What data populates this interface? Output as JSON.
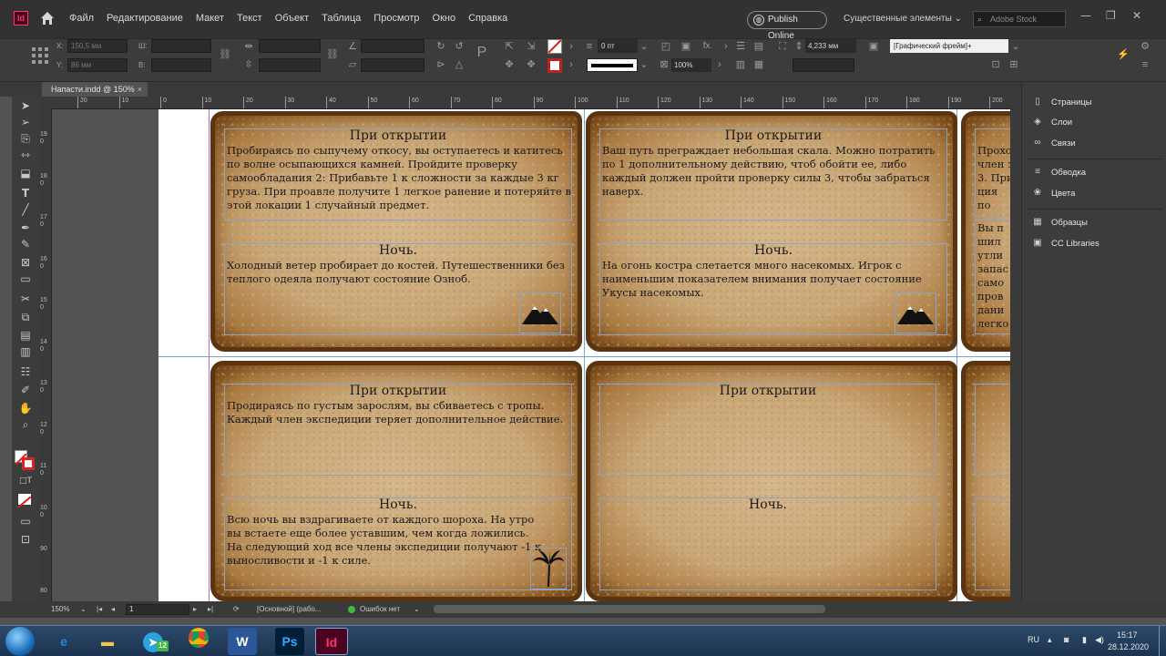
{
  "app": {
    "logo_text": "Id"
  },
  "menu": {
    "items": [
      "Файл",
      "Редактирование",
      "Макет",
      "Текст",
      "Объект",
      "Таблица",
      "Просмотр",
      "Окно",
      "Справка"
    ],
    "publish_label": "Publish Online",
    "workspace_label": "Существенные элементы",
    "stock_placeholder": "Adobe Stock"
  },
  "control": {
    "x_label": "X:",
    "y_label": "Y:",
    "w_label": "Ш:",
    "h_label": "В:",
    "x_value": "150,5 мм",
    "y_value": "86 мм",
    "stroke_weight": "0 пт",
    "scale": "100%",
    "gap_value": "4,233 мм",
    "frame_style": "[Графический фрейм]+"
  },
  "document_tab": {
    "title": "Напасти.indd @ 150%"
  },
  "rulers": {
    "h_labels": [
      "20",
      "10",
      "0",
      "10",
      "20",
      "30",
      "40",
      "50",
      "60",
      "70",
      "80",
      "90",
      "100",
      "110",
      "120",
      "130",
      "140",
      "150",
      "160",
      "170",
      "180",
      "190",
      "200"
    ],
    "v_labels": [
      "190",
      "180",
      "170",
      "160",
      "150",
      "140",
      "130",
      "120",
      "110",
      "100",
      "90",
      "80"
    ]
  },
  "cards": [
    {
      "title_top": "При открытии",
      "body_top": "Пробираясь по сыпучему откосу, вы оступаетесь и катитесь по волне осыпающихся камней. Пройдите проверку самообладания 2: Прибавьте 1 к сложности за каждые 3 кг груза. При проавле получите 1 легкое ранение и потеряйте в этой локации 1 случайный предмет.",
      "title_bottom": "Ночь.",
      "body_bottom": "Холодный ветер пробирает до костей. Путешественники без теплого одеяла получают состояние Озноб.",
      "icon": "mountain-icon"
    },
    {
      "title_top": "При открытии",
      "body_top": "Ваш путь преграждает небольшая скала. Можно потратить по 1 дополнительному действию, чтоб обойти ее, либо каждый должен пройти проверку силы 3, чтобы забраться наверх.",
      "title_bottom": "Ночь.",
      "body_bottom": "На огонь костра слетается много насекомых. Игрок с наименьшим показателем внимания получает состояние Укусы насекомых.",
      "icon": "mountain-icon"
    },
    {
      "title_top": "",
      "body_top": "Прохо член з 3. При ция по",
      "title_bottom": "",
      "body_bottom": "Вы п шил утли запас само пров дани легко",
      "icon": ""
    },
    {
      "title_top": "При открытии",
      "body_top": "Продираясь по густым зарослям, вы сбиваетесь с тропы. Каждый член экспедиции теряет дополнительное действие.",
      "title_bottom": "Ночь.",
      "body_bottom": "Всю ночь вы вздрагиваете от каждого шороха. На утро вы встаете еще более уставшим, чем когда ложились. На следующий ход все члены экспедиции получают -1 к выносливости и -1 к силе.",
      "icon": "palm-tree-icon"
    },
    {
      "title_top": "При открытии",
      "body_top": "",
      "title_bottom": "Ночь.",
      "body_bottom": "",
      "icon": ""
    }
  ],
  "panels": {
    "items": [
      "Страницы",
      "Слои",
      "Связи",
      "Обводка",
      "Цвета",
      "Образцы",
      "CC Libraries"
    ]
  },
  "status": {
    "zoom": "150%",
    "page": "1",
    "style": "[Основной] (рабо...",
    "preflight": "Ошибок нет"
  },
  "taskbar": {
    "telegram_badge": "12",
    "lang": "RU",
    "time": "15:17",
    "date": "28.12.2020"
  },
  "colors": {
    "accent_indesign": "#ff3366",
    "guide_blue": "#6fa5d8",
    "margin_magenta": "#c463c4",
    "parchment": "#c9a676"
  }
}
